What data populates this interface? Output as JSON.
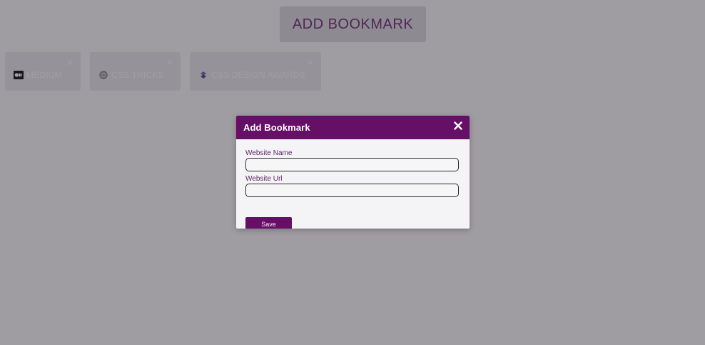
{
  "colors": {
    "accent": "#660f66",
    "button_text": "#6a1a70",
    "card_bg": "#e6e5e8",
    "overlay": "rgba(55,50,60,0.46)",
    "modal_bg": "#f4f3f6",
    "label_text": "#5c2a62"
  },
  "header": {
    "add_bookmark_label": "ADD BOOKMARK"
  },
  "bookmarks": [
    {
      "name": "MEDIUM",
      "favicon": "medium-icon"
    },
    {
      "name": "CSS TRICKS",
      "favicon": "globe-icon"
    },
    {
      "name": "CSS DESIGN AWARDS",
      "favicon": "cssda-icon"
    }
  ],
  "bookmark_delete_icon": "close-icon",
  "modal": {
    "title": "Add Bookmark",
    "close_icon": "close-icon",
    "fields": [
      {
        "label": "Website Name",
        "value": "",
        "placeholder": ""
      },
      {
        "label": "Website Url",
        "value": "",
        "placeholder": ""
      }
    ],
    "save_label": "Save"
  }
}
